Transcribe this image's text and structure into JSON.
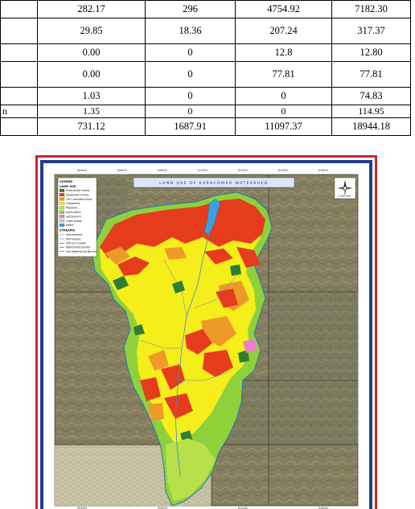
{
  "table": {
    "rows": [
      {
        "label": "",
        "cells": [
          "282.17",
          "296",
          "4754.92",
          "7182.30"
        ],
        "style": "normal"
      },
      {
        "label": "",
        "cells": [
          "29.85",
          "18.36",
          "207.24",
          "317.37"
        ],
        "style": "tall"
      },
      {
        "label": "",
        "cells": [
          "0.00",
          "0",
          "12.8",
          "12.80"
        ],
        "style": "normal"
      },
      {
        "label": "",
        "cells": [
          "0.00",
          "0",
          "77.81",
          "77.81"
        ],
        "style": "tall"
      },
      {
        "label": "",
        "cells": [
          "1.03",
          "0",
          "0",
          "74.83"
        ],
        "style": "normal"
      },
      {
        "label": "n",
        "cells": [
          "1.35",
          "0",
          "0",
          "114.95"
        ],
        "style": "short"
      },
      {
        "label": "",
        "cells": [
          "731.12",
          "1687.91",
          "11097.37",
          "18944.18"
        ],
        "style": "normal"
      }
    ]
  },
  "map": {
    "title": "LAND USE OF KARACOMAR WATERSHED",
    "legend": {
      "heading": "LEGEND",
      "section_land_use": "LAND USE",
      "land_use_items": [
        {
          "label": "Productive Forest",
          "color": "#2f7d2f"
        },
        {
          "label": "Degraded Forest",
          "color": "#e63c1e"
        },
        {
          "label": "OR Cultivated Area",
          "color": "#ee9a2a"
        },
        {
          "label": "Grassland",
          "color": "#f6ee1a"
        },
        {
          "label": "Meadow",
          "color": "#b8e04a"
        },
        {
          "label": "Agriculture",
          "color": "#8fd13a"
        },
        {
          "label": "Settlement",
          "color": "#e88aa8"
        },
        {
          "label": "Open Areas",
          "color": "#c8c8c8"
        },
        {
          "label": "Water",
          "color": "#3aa0e0"
        }
      ],
      "section_streams": "STREAMS",
      "stream_items": [
        "Intermittent",
        "Permanent",
        "District Capital",
        "Watershed Border",
        "Sub-Watershed Border"
      ]
    },
    "colors": {
      "frame_red": "#c82828",
      "frame_blue": "#243c8c",
      "topo_background": "#8a8a6a"
    },
    "scale_label": "1:100 000"
  }
}
